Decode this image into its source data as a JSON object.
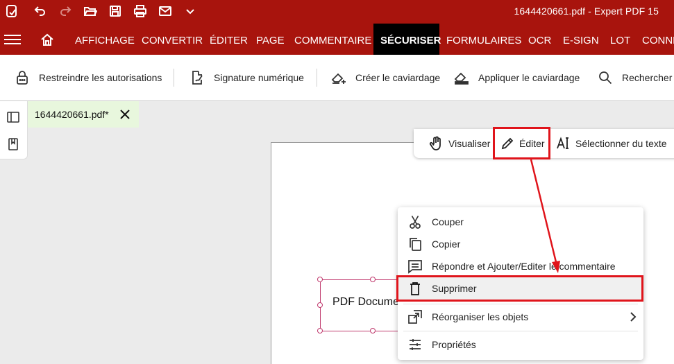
{
  "titlebar": {
    "title": "1644420661.pdf   -   Expert PDF 15"
  },
  "menubar": {
    "tabs": [
      {
        "label": "AFFICHAGE",
        "active": false
      },
      {
        "label": "CONVERTIR",
        "active": false
      },
      {
        "label": "ÉDITER",
        "active": false
      },
      {
        "label": "PAGE",
        "active": false
      },
      {
        "label": "COMMENTAIRE",
        "active": false
      },
      {
        "label": "SÉCURISER",
        "active": true
      },
      {
        "label": "FORMULAIRES",
        "active": false
      },
      {
        "label": "OCR",
        "active": false
      },
      {
        "label": "E-SIGN",
        "active": false
      },
      {
        "label": "LOT",
        "active": false
      },
      {
        "label": "CONNE",
        "active": false
      }
    ]
  },
  "ribbon": {
    "restrict": "Restreindre les autorisations",
    "signature": "Signature numérique",
    "create_redaction": "Créer le caviardage",
    "apply_redaction": "Appliquer le caviardage",
    "search": "Rechercher e"
  },
  "document_tab": {
    "name": "1644420661.pdf*"
  },
  "modebar": {
    "view": "Visualiser",
    "edit": "Éditer",
    "select_text": "Sélectionner du texte"
  },
  "textbox": {
    "content": "PDF Docume"
  },
  "context_menu": {
    "items": [
      {
        "label": "Couper",
        "icon": "scissors-icon"
      },
      {
        "label": "Copier",
        "icon": "copy-icon"
      },
      {
        "label": "Répondre et Ajouter/Editer le commentaire",
        "icon": "comment-icon"
      },
      {
        "label": "Supprimer",
        "icon": "trash-icon"
      },
      {
        "label": "Réorganiser les objets",
        "icon": "arrange-icon"
      },
      {
        "label": "Propriétés",
        "icon": "sliders-icon"
      }
    ]
  },
  "colors": {
    "brand_red": "#a8140d",
    "annotation_red": "#e0141b",
    "selection_pink": "#c0396d",
    "doc_tab_green": "#e8f7dd"
  }
}
